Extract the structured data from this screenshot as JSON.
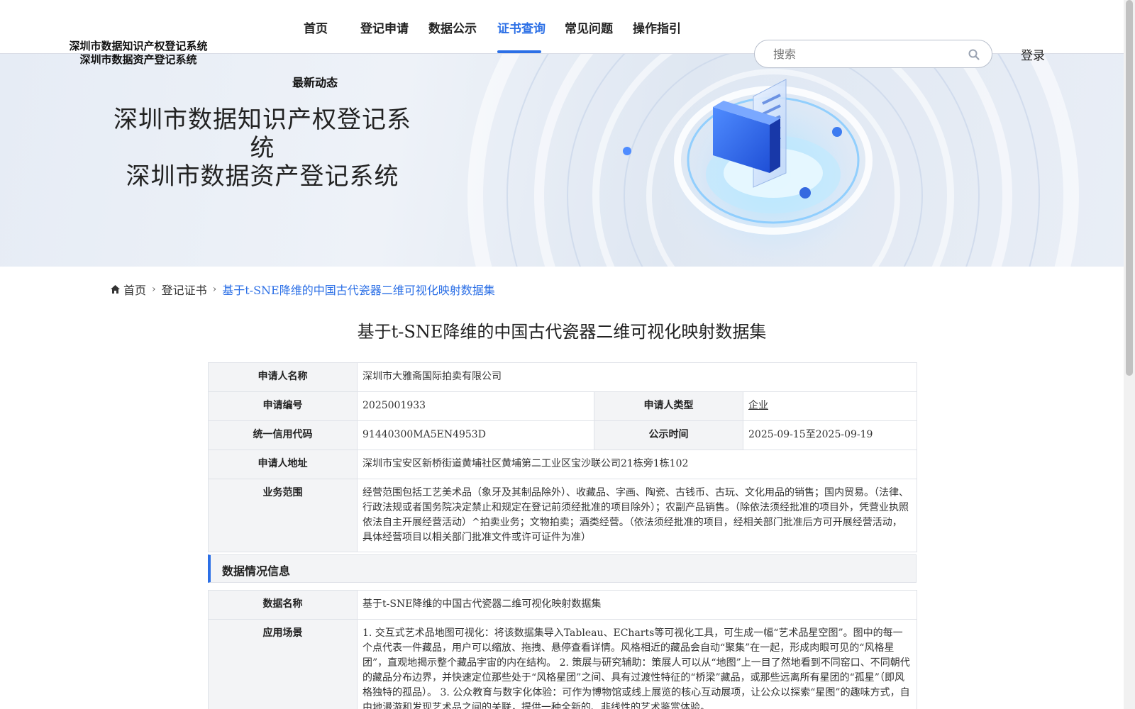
{
  "header": {
    "logo_line1": "深圳市数据知识产权登记系统",
    "logo_line2": "深圳市数据资产登记系统",
    "nav": [
      "首页",
      "登记申请",
      "数据公示",
      "证书查询",
      "常见问题",
      "操作指引"
    ],
    "nav_active": "证书查询",
    "nav_news": "最新动态",
    "search_placeholder": "搜索",
    "login_label": "登录"
  },
  "banner": {
    "title_line1": "深圳市数据知识产权登记系统",
    "title_line2": "深圳市数据资产登记系统"
  },
  "breadcrumb": {
    "home": "首页",
    "level2": "登记证书",
    "current": "基于t-SNE降维的中国古代瓷器二维可视化映射数据集"
  },
  "page_title": "基于t-SNE降维的中国古代瓷器二维可视化映射数据集",
  "applicant": {
    "name_label": "申请人名称",
    "name": "深圳市大雅斋国际拍卖有限公司",
    "number_label": "申请编号",
    "number": "2025001933",
    "type_label": "申请人类型",
    "type": "企业",
    "credit_label": "统一信用代码",
    "credit": "91440300MA5EN4953D",
    "publicity_label": "公示时间",
    "publicity": "2025-09-15至2025-09-19",
    "address_label": "申请人地址",
    "address": "深圳市宝安区新桥街道黄埔社区黄埔第二工业区宝沙联公司21栋旁1栋102",
    "scope_label": "业务范围",
    "scope": "经营范围包括工艺美术品（象牙及其制品除外）、收藏品、字画、陶瓷、古钱币、古玩、文化用品的销售；国内贸易。（法律、行政法规或者国务院决定禁止和规定在登记前须经批准的项目除外）；农副产品销售。（除依法须经批准的项目外，凭营业执照依法自主开展经营活动）^拍卖业务；文物拍卖；酒类经营。（依法须经批准的项目，经相关部门批准后方可开展经营活动，具体经营项目以相关部门批准文件或许可证件为准）"
  },
  "data_section": {
    "heading": "数据情况信息",
    "data_name_label": "数据名称",
    "data_name": "基于t-SNE降维的中国古代瓷器二维可视化映射数据集",
    "scenario_label": "应用场景",
    "scenario": "1. 交互式艺术品地图可视化：将该数据集导入Tableau、ECharts等可视化工具，可生成一幅“艺术品星空图”。图中的每一个点代表一件藏品，用户可以缩放、拖拽、悬停查看详情。风格相近的藏品会自动“聚集”在一起，形成肉眼可见的“风格星团”，直观地揭示整个藏品宇宙的内在结构。 2. 策展与研究辅助：策展人可以从“地图”上一目了然地看到不同窑口、不同朝代的藏品分布边界，并快速定位那些处于“风格星团”之间、具有过渡性特征的“桥梁”藏品，或那些远离所有星团的“孤星”（即风格独特的孤品）。 3. 公众教育与数字化体验：可作为博物馆或线上展览的核心互动展项，让公众以探索“星图”的趣味方式，自由地漫游和发现艺术品之间的关联，提供一种全新的、非线性的艺术鉴赏体验。"
  },
  "colors": {
    "accent": "#2b6fe6",
    "label_bg": "#f3f4f6",
    "border": "#dfe2e8"
  }
}
